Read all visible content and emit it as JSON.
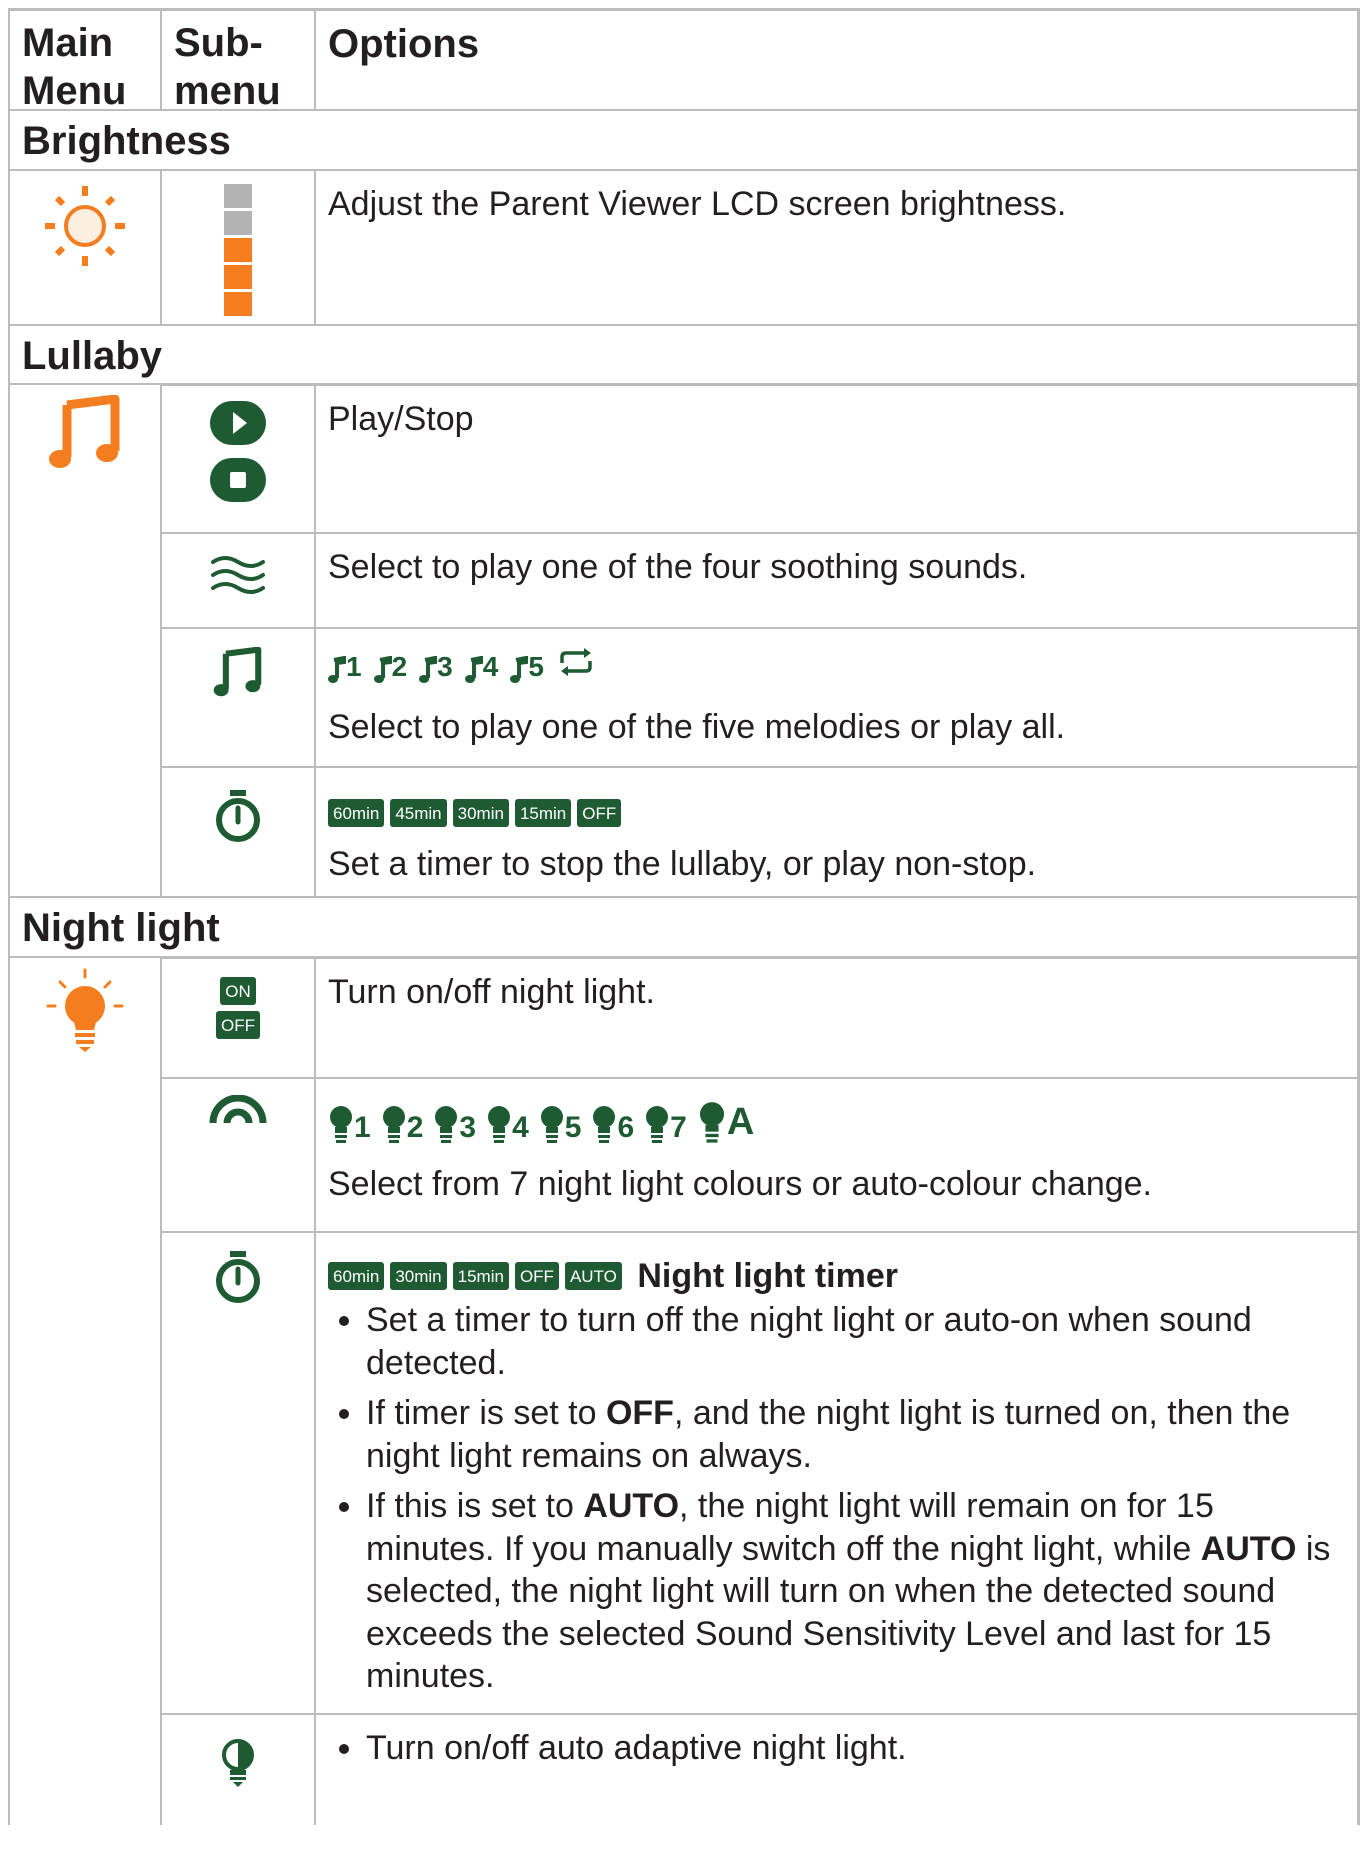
{
  "header": {
    "col1": "Main Menu",
    "col2": "Sub-menu",
    "col3": "Options"
  },
  "brightness": {
    "title": "Brightness",
    "desc": "Adjust the Parent Viewer LCD screen brightness.",
    "levels_filled": 3,
    "levels_total": 5
  },
  "lullaby": {
    "title": "Lullaby",
    "play_stop": "Play/Stop",
    "sounds_desc": "Select to play one of the four soothing sounds.",
    "melodies": [
      "1",
      "2",
      "3",
      "4",
      "5"
    ],
    "melodies_desc": "Select to play one of the five melodies or play all.",
    "timer_options": [
      "60min",
      "45min",
      "30min",
      "15min",
      "OFF"
    ],
    "timer_desc": "Set a timer to stop the lullaby, or play non-stop."
  },
  "night_light": {
    "title": "Night light",
    "on_label": "ON",
    "off_label": "OFF",
    "onoff_desc": "Turn on/off night light.",
    "colours": [
      "1",
      "2",
      "3",
      "4",
      "5",
      "6",
      "7",
      "A"
    ],
    "colours_desc": "Select from 7 night light colours or auto-colour change.",
    "timer_options": [
      "60min",
      "30min",
      "15min",
      "OFF",
      "AUTO"
    ],
    "timer_title": "Night light timer",
    "timer_bullet1": "Set a timer to turn off the night light or auto-on when sound detected.",
    "timer_bullet2_pre": "If timer is set to ",
    "timer_bullet2_bold": "OFF",
    "timer_bullet2_post": ", and the night light is turned on, then the night light remains on always.",
    "timer_bullet3_pre": "If this is set to ",
    "timer_bullet3_bold1": "AUTO",
    "timer_bullet3_mid": ", the night light will remain on for 15 minutes. If you manually switch off the night light, while ",
    "timer_bullet3_bold2": "AUTO",
    "timer_bullet3_post": " is selected, the night light will turn on when the detected sound exceeds the selected Sound Sensitivity Level and last for 15 minutes.",
    "adaptive_desc": "Turn on/off auto adaptive night light."
  },
  "colors": {
    "orange": "#f47d20",
    "green": "#1e5b32",
    "grey": "#bcbcbc"
  },
  "icons": [
    "sun-icon",
    "brightness-level-icon",
    "music-note-icon",
    "play-icon",
    "stop-icon",
    "waves-icon",
    "stopwatch-icon",
    "bulb-icon",
    "arc-icon",
    "adaptive-bulb-icon"
  ]
}
